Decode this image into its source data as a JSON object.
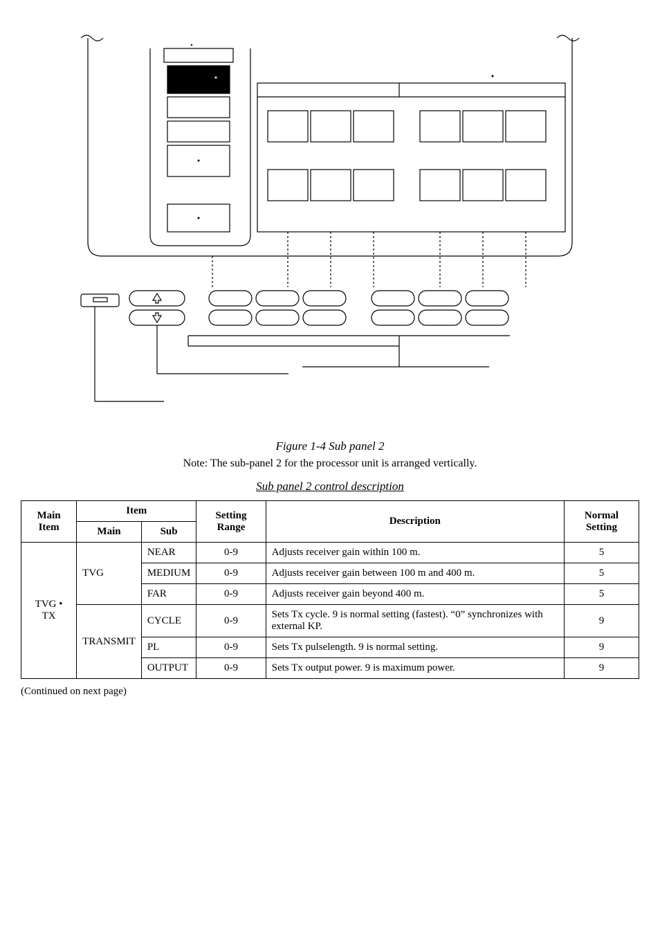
{
  "figure_caption": "Figure 1-4 Sub panel 2",
  "note": "Note: The sub-panel 2 for the processor unit is arranged vertically.",
  "table_title": "Sub panel 2 control description",
  "headers": {
    "main_item": "Main Item",
    "item": "Item",
    "main": "Main",
    "sub": "Sub",
    "setting_range": "Setting Range",
    "description": "Description",
    "normal_setting": "Normal Setting"
  },
  "rows": [
    {
      "main_item": "TVG • TX",
      "main": "TVG",
      "sub": "NEAR",
      "range": "0-9",
      "desc": "Adjusts receiver gain within 100 m.",
      "normal": "5"
    },
    {
      "sub": "MEDIUM",
      "range": "0-9",
      "desc": "Adjusts receiver gain between 100 m and 400 m.",
      "normal": "5"
    },
    {
      "sub": "FAR",
      "range": "0-9",
      "desc": "Adjusts receiver gain beyond 400 m.",
      "normal": "5"
    },
    {
      "main": "TRANSMIT",
      "sub": "CYCLE",
      "range": "0-9",
      "desc": "Sets Tx cycle. 9 is normal setting (fastest). “0” synchronizes with external KP.",
      "normal": "9"
    },
    {
      "sub": "PL",
      "range": "0-9",
      "desc": "Sets Tx pulselength. 9 is normal setting.",
      "normal": "9"
    },
    {
      "sub": "OUTPUT",
      "range": "0-9",
      "desc": "Sets Tx output power. 9 is maximum power.",
      "normal": "9"
    }
  ],
  "continued": "(Continued on next page)"
}
